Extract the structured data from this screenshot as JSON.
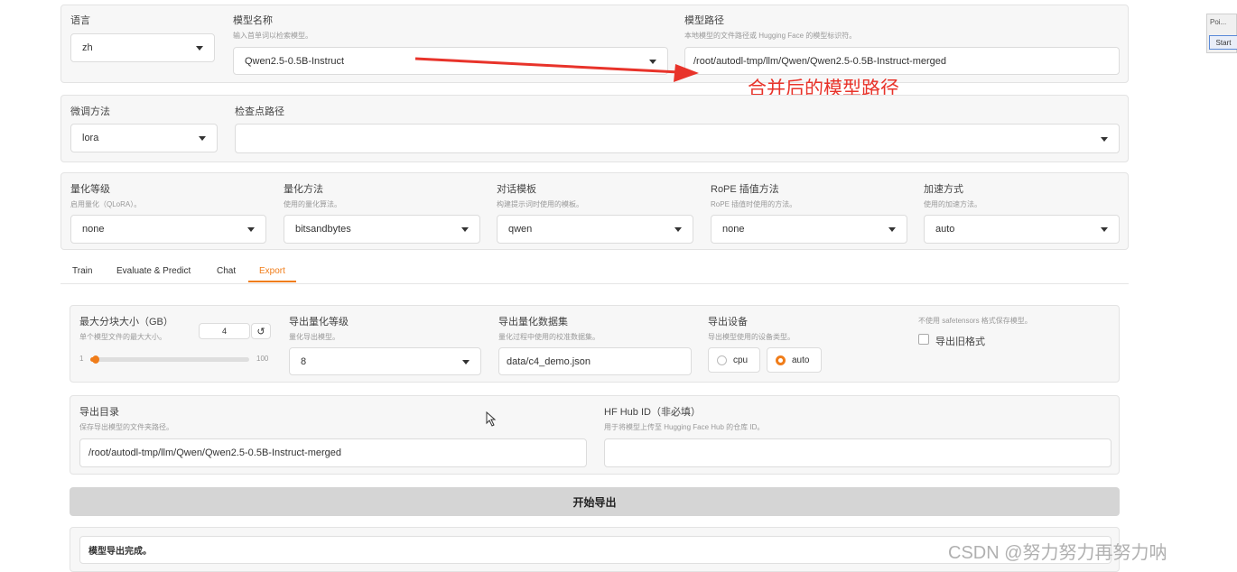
{
  "top_row": {
    "language": {
      "label": "语言",
      "value": "zh"
    },
    "model_name": {
      "label": "模型名称",
      "hint": "输入首单词以检索模型。",
      "value": "Qwen2.5-0.5B-Instruct"
    },
    "model_path": {
      "label": "模型路径",
      "hint": "本地模型的文件路径或 Hugging Face 的模型标识符。",
      "value": "/root/autodl-tmp/llm/Qwen/Qwen2.5-0.5B-Instruct-merged"
    }
  },
  "annotation": {
    "text": "合并后的模型路径",
    "color": "#e8332a"
  },
  "finetune_row": {
    "method": {
      "label": "微调方法",
      "value": "lora"
    },
    "checkpoint": {
      "label": "检查点路径",
      "value": ""
    }
  },
  "quant_row": {
    "quant_bit": {
      "label": "量化等级",
      "hint": "启用量化（QLoRA）。",
      "value": "none"
    },
    "quant_method": {
      "label": "量化方法",
      "hint": "使用的量化算法。",
      "value": "bitsandbytes"
    },
    "template": {
      "label": "对话模板",
      "hint": "构建提示词时使用的模板。",
      "value": "qwen"
    },
    "rope": {
      "label": "RoPE 插值方法",
      "hint": "RoPE 插值时使用的方法。",
      "value": "none"
    },
    "booster": {
      "label": "加速方式",
      "hint": "使用的加速方法。",
      "value": "auto"
    }
  },
  "tabs": [
    {
      "label": "Train",
      "active": false
    },
    {
      "label": "Evaluate & Predict",
      "active": false
    },
    {
      "label": "Chat",
      "active": false
    },
    {
      "label": "Export",
      "active": true
    }
  ],
  "export": {
    "shard_size": {
      "label": "最大分块大小（GB）",
      "hint": "单个模型文件的最大大小。",
      "value": "4",
      "min": "1",
      "max": "100",
      "fraction": 0.03
    },
    "export_quant_bit": {
      "label": "导出量化等级",
      "hint": "量化导出模型。",
      "value": "8"
    },
    "quant_dataset": {
      "label": "导出量化数据集",
      "hint": "量化过程中使用的校准数据集。",
      "value": "data/c4_demo.json"
    },
    "device": {
      "label": "导出设备",
      "hint": "导出模型使用的设备类型。",
      "options": [
        {
          "label": "cpu",
          "selected": false
        },
        {
          "label": "auto",
          "selected": true
        }
      ]
    },
    "legacy": {
      "hint": "不使用 safetensors 格式保存模型。",
      "label": "导出旧格式",
      "checked": false
    },
    "export_dir": {
      "label": "导出目录",
      "hint": "保存导出模型的文件夹路径。",
      "value": "/root/autodl-tmp/llm/Qwen/Qwen2.5-0.5B-Instruct-merged"
    },
    "hub_id": {
      "label": "HF Hub ID（非必填）",
      "hint": "用于将模型上传至 Hugging Face Hub 的仓库 ID。",
      "value": ""
    },
    "start_button": "开始导出",
    "output": "模型导出完成。"
  },
  "side_window": {
    "title": "Poi...",
    "button": "Start"
  },
  "watermark": "CSDN @努力努力再努力呐",
  "accent_color": "#f07d1a"
}
